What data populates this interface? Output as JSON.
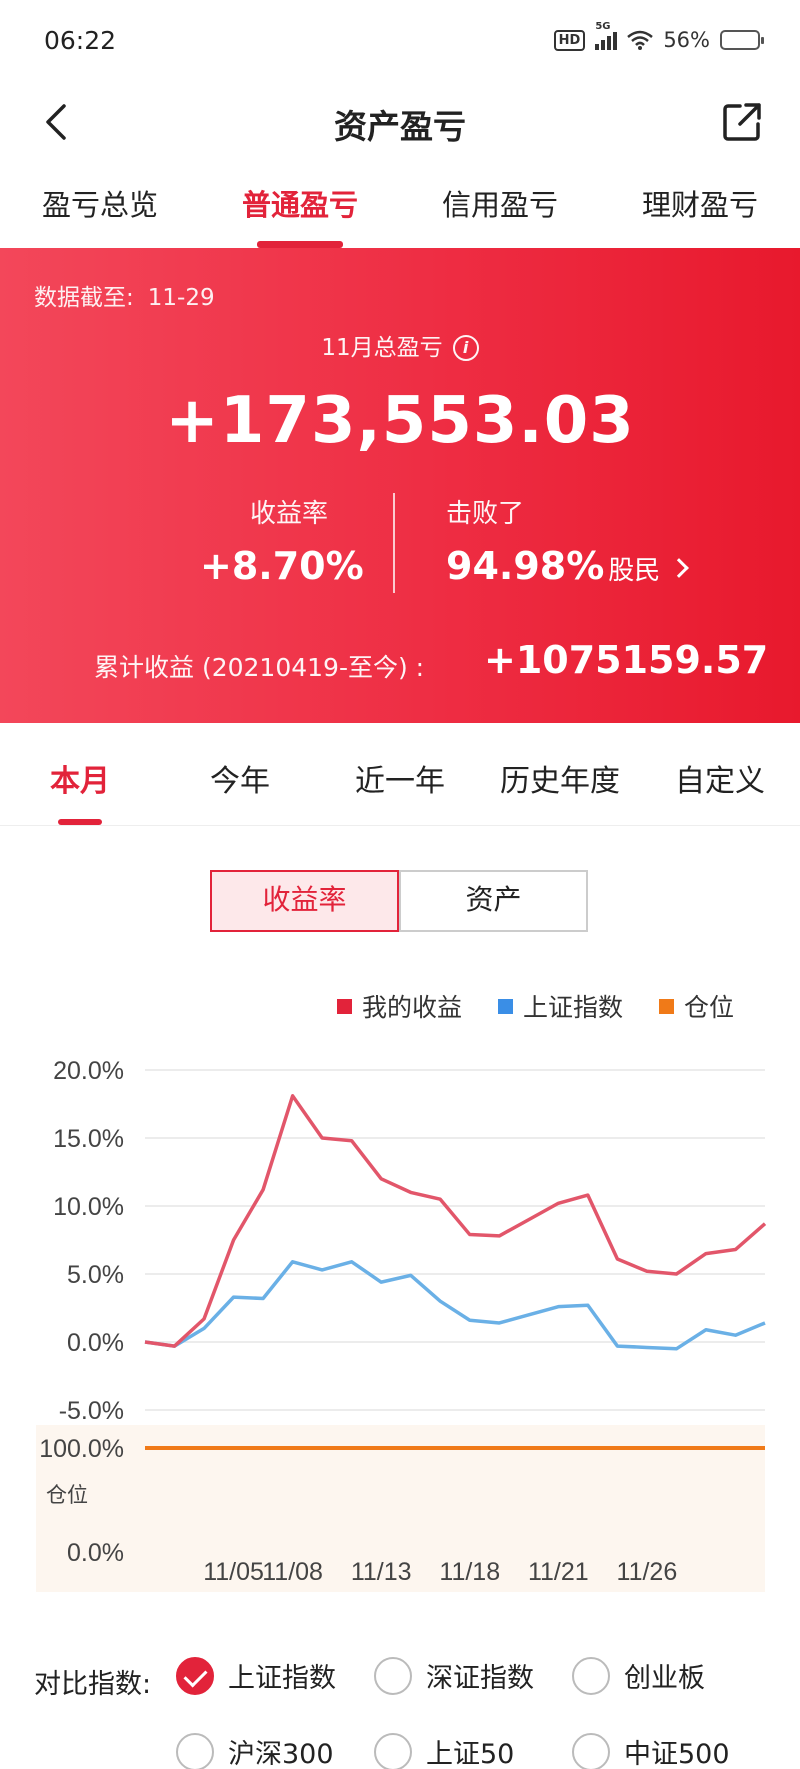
{
  "status_bar": {
    "time": "06:22",
    "network": "5G",
    "battery": "56%",
    "battery_level": 0.56,
    "hd": "HD"
  },
  "header": {
    "title": "资产盈亏"
  },
  "top_tabs": [
    {
      "label": "盈亏总览",
      "active": false
    },
    {
      "label": "普通盈亏",
      "active": true
    },
    {
      "label": "信用盈亏",
      "active": false
    },
    {
      "label": "理财盈亏",
      "active": false
    }
  ],
  "banner": {
    "asof_label": "数据截至:",
    "asof_date": "11-29",
    "month_label": "11月总盈亏",
    "info_icon": "i",
    "total_pnl": "+173,553.03",
    "return_label": "收益率",
    "return_value": "+8.70%",
    "beat_label": "击败了",
    "beat_value": "94.98%",
    "beat_suffix": "股民",
    "cumulative_label": "累计收益 (20210419-至今) :",
    "cumulative_value": "+1075159.57"
  },
  "period_tabs": [
    {
      "label": "本月",
      "active": true
    },
    {
      "label": "今年",
      "active": false
    },
    {
      "label": "近一年",
      "active": false
    },
    {
      "label": "历史年度",
      "active": false
    },
    {
      "label": "自定义",
      "active": false
    }
  ],
  "segmented": [
    {
      "label": "收益率",
      "active": true
    },
    {
      "label": "资产",
      "active": false
    }
  ],
  "legend": [
    {
      "label": "我的收益",
      "color": "#e2233a"
    },
    {
      "label": "上证指数",
      "color": "#3a8ee6"
    },
    {
      "label": "仓位",
      "color": "#f07a18"
    }
  ],
  "chart_data": {
    "type": "line",
    "y_ticks": [
      "20.0%",
      "15.0%",
      "10.0%",
      "5.0%",
      "0.0%",
      "-5.0%"
    ],
    "ylim": [
      -5,
      20
    ],
    "x_tick_labels": [
      "11/05",
      "11/08",
      "11/13",
      "11/18",
      "11/21",
      "11/26"
    ],
    "x_tick_index": [
      3,
      5,
      8,
      11,
      14,
      17
    ],
    "series": [
      {
        "name": "我的收益",
        "color": "#e2566a",
        "values": [
          0.0,
          -0.3,
          1.7,
          7.5,
          11.2,
          18.1,
          15.0,
          14.8,
          12.0,
          11.0,
          10.5,
          7.9,
          7.8,
          9.0,
          10.2,
          10.8,
          6.1,
          5.2,
          5.0,
          6.5,
          6.8,
          8.7
        ]
      },
      {
        "name": "上证指数",
        "color": "#6ab0e6",
        "values": [
          0.0,
          -0.3,
          1.0,
          3.3,
          3.2,
          5.9,
          5.3,
          5.9,
          4.4,
          4.9,
          3.0,
          1.6,
          1.4,
          2.0,
          2.6,
          2.7,
          -0.3,
          -0.4,
          -0.5,
          0.9,
          0.5,
          1.4
        ]
      }
    ],
    "position": {
      "name": "仓位",
      "color": "#f07a18",
      "label": "仓位",
      "y_ticks": [
        "100.0%",
        "0.0%"
      ],
      "values": [
        100,
        100,
        100,
        100,
        100,
        100,
        100,
        100,
        100,
        100,
        100,
        100,
        100,
        100,
        100,
        100,
        100,
        100,
        100,
        100,
        100,
        100
      ]
    }
  },
  "compare": {
    "label": "对比指数:",
    "options": [
      {
        "label": "上证指数",
        "checked": true
      },
      {
        "label": "深证指数",
        "checked": false
      },
      {
        "label": "创业板",
        "checked": false
      },
      {
        "label": "沪深300",
        "checked": false
      },
      {
        "label": "上证50",
        "checked": false
      },
      {
        "label": "中证500",
        "checked": false
      }
    ]
  }
}
